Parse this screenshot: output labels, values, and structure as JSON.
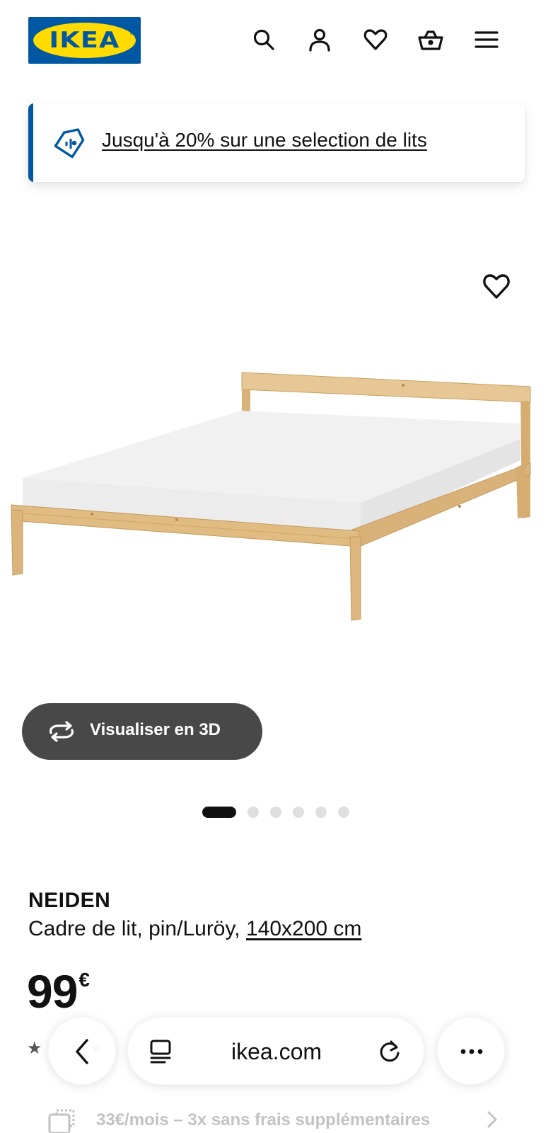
{
  "header": {
    "logo_text": "IKEA",
    "logo_registered": "®",
    "icons": [
      "search-icon",
      "account-icon",
      "heart-icon",
      "basket-icon",
      "menu-icon"
    ],
    "brand_blue": "#0058a3",
    "brand_yellow": "#ffdb00"
  },
  "promo": {
    "text": "Jusqu'à 20% sur une selection de lits",
    "icon": "tag-icon",
    "accent": "#0058a3"
  },
  "product_media": {
    "favorite_icon": "heart-icon",
    "view3d_label": "Visualiser en 3D",
    "view3d_icon": "rotate-3d-icon",
    "carousel_total": 6,
    "carousel_active": 1
  },
  "product": {
    "name": "NEIDEN",
    "description": "Cadre de lit, pin/Luröy,",
    "size": "140x200 cm",
    "price": "99",
    "currency": "€"
  },
  "finance": {
    "text": "33€/mois – 3x sans frais supplémentaires"
  },
  "browser": {
    "domain": "ikea.com",
    "icons": [
      "back-icon",
      "tabs-icon",
      "reload-icon",
      "more-icon"
    ]
  }
}
